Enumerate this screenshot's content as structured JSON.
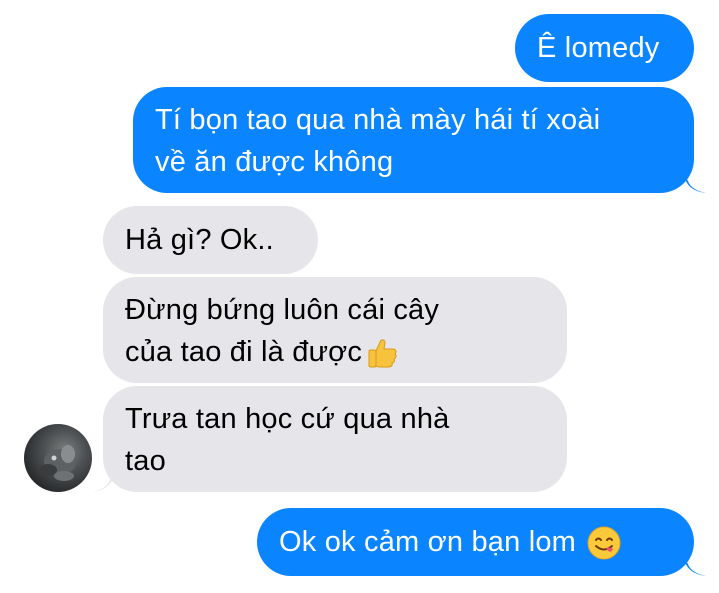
{
  "conversation": {
    "messages": [
      {
        "direction": "outgoing",
        "text": "Ê lomedy"
      },
      {
        "direction": "outgoing",
        "text": "Tí bọn tao qua nhà mày hái tí xoài\nvề ăn được không"
      },
      {
        "direction": "incoming",
        "text": "Hả gì? Ok.."
      },
      {
        "direction": "incoming",
        "text": "Đừng bứng luôn cái cây\ncủa tao đi là được",
        "emoji": "thumbs-up-emoji"
      },
      {
        "direction": "incoming",
        "text": "Trưa tan học cứ qua nhà\ntao"
      },
      {
        "direction": "outgoing",
        "text": "Ok ok cảm ơn bạn lom",
        "emoji": "face-savoring-food-emoji"
      }
    ]
  },
  "colors": {
    "outgoing_bubble": "#0a84ff",
    "incoming_bubble": "#e5e5ea",
    "outgoing_text": "#ffffff",
    "incoming_text": "#000000"
  }
}
